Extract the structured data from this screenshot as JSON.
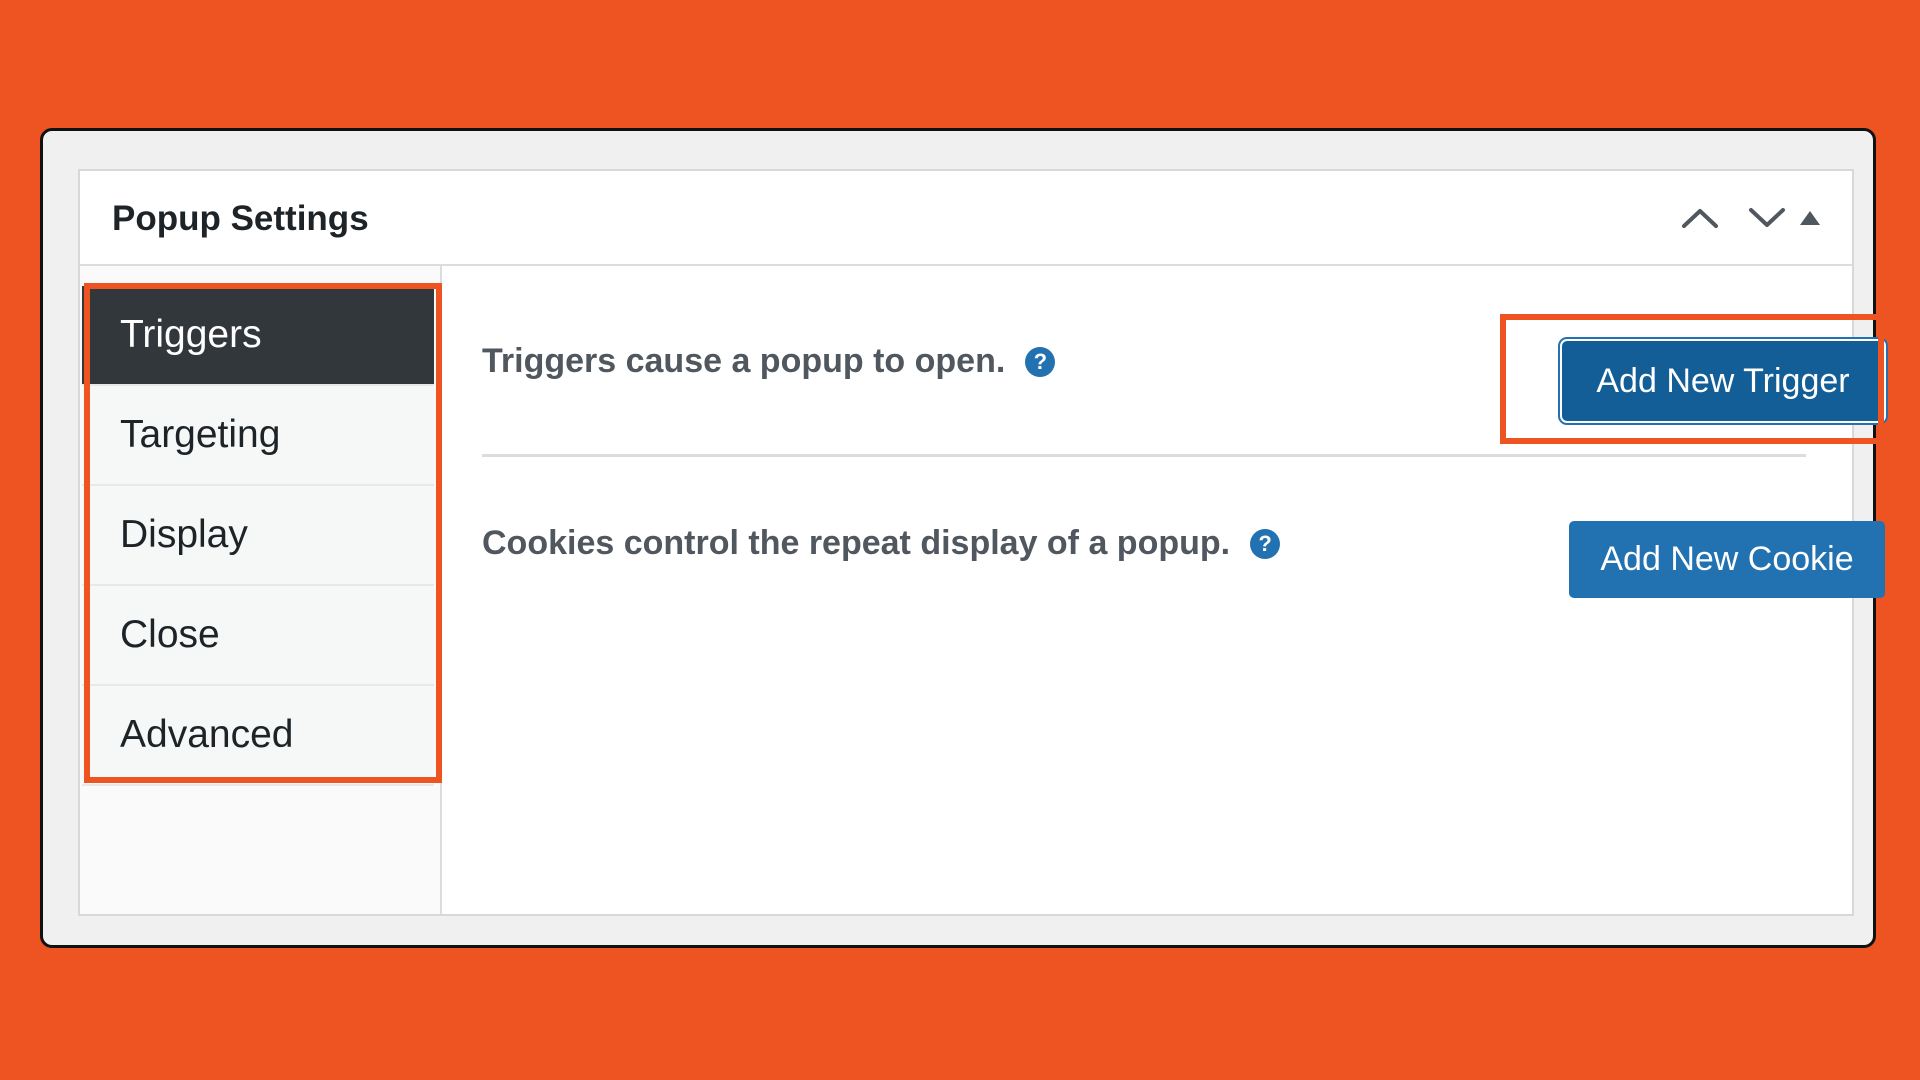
{
  "panel": {
    "title": "Popup Settings",
    "header_controls": [
      "move-up-icon",
      "move-down-icon",
      "toggle-panel-icon"
    ]
  },
  "tabs": [
    {
      "label": "Triggers",
      "active": true
    },
    {
      "label": "Targeting",
      "active": false
    },
    {
      "label": "Display",
      "active": false
    },
    {
      "label": "Close",
      "active": false
    },
    {
      "label": "Advanced",
      "active": false
    }
  ],
  "content": {
    "triggers": {
      "description": "Triggers cause a popup to open.",
      "help_icon": "?",
      "button_label": "Add New Trigger"
    },
    "cookies": {
      "description": "Cookies control the repeat display of a popup.",
      "help_icon": "?",
      "button_label": "Add New Cookie"
    }
  },
  "colors": {
    "background": "#EE5322",
    "highlight": "#EE5322",
    "button": "#2271b1",
    "active_tab": "#32373c"
  }
}
